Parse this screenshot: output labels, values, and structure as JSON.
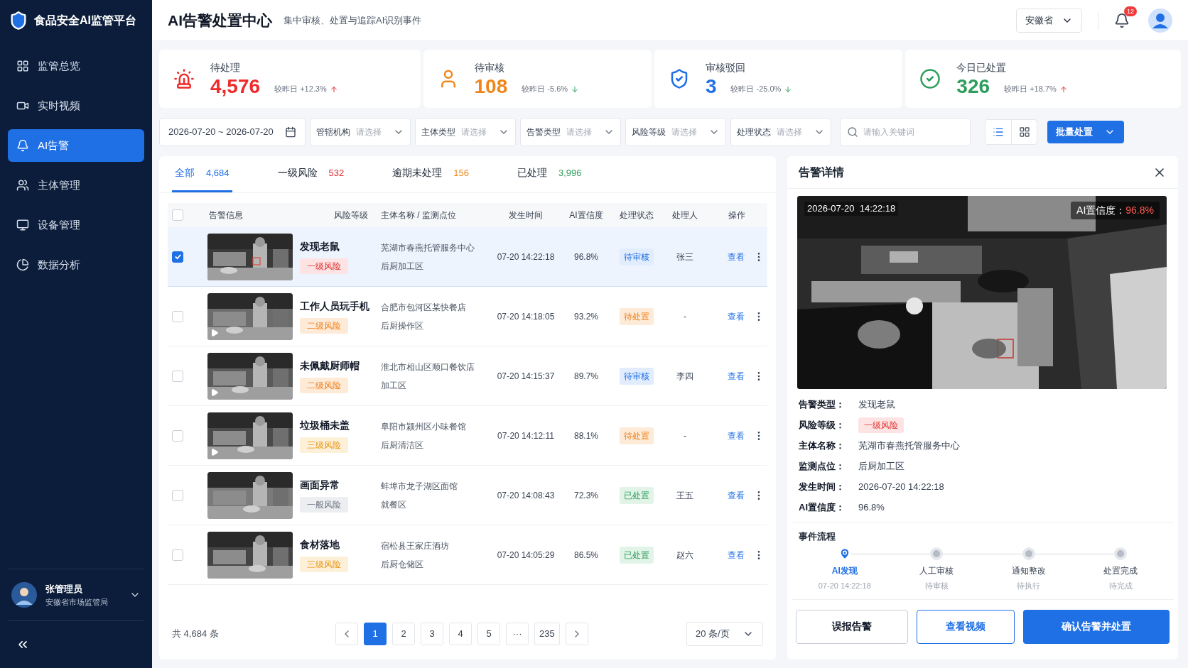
{
  "sidebar": {
    "brand": "食品安全AI监管平台",
    "items": [
      {
        "kind": "overview",
        "label": "监管总览",
        "selected": false
      },
      {
        "kind": "video",
        "label": "实时视频",
        "selected": false
      },
      {
        "kind": "alert",
        "label": "AI告警",
        "selected": true
      },
      {
        "kind": "entity",
        "label": "主体管理",
        "selected": false
      },
      {
        "kind": "device",
        "label": "设备管理",
        "selected": false
      },
      {
        "kind": "analytics",
        "label": "数据分析",
        "selected": false
      }
    ],
    "user": {
      "name": "张管理员",
      "org": "安徽省市场监管局"
    }
  },
  "header": {
    "title": "AI告警处置中心",
    "subtitle": "集中审核、处置与追踪AI识别事件",
    "region": "安徽省",
    "notification_count": "12"
  },
  "stats": [
    {
      "kind": "alarm",
      "label": "待处理",
      "value": "4,576",
      "color": "#ee2a2a",
      "compare": "较昨日 +12.3%",
      "rising": true
    },
    {
      "kind": "person",
      "label": "待审核",
      "value": "108",
      "color": "#f0861a",
      "compare": "较昨日 -5.6%",
      "rising": false
    },
    {
      "kind": "shield",
      "label": "审核驳回",
      "value": "3",
      "color": "#1f6fe5",
      "compare": "较昨日 -25.0%",
      "rising": false
    },
    {
      "kind": "check",
      "label": "今日已处置",
      "value": "326",
      "color": "#2e9d5c",
      "compare": "较昨日 +18.7%",
      "rising": true
    }
  ],
  "filters": {
    "date_range": "2026-07-20 ~ 2026-07-20",
    "selects": [
      {
        "label": "管辖机构",
        "placeholder": "请选择"
      },
      {
        "label": "主体类型",
        "placeholder": "请选择"
      },
      {
        "label": "告警类型",
        "placeholder": "请选择"
      },
      {
        "label": "风险等级",
        "placeholder": "请选择"
      },
      {
        "label": "处理状态",
        "placeholder": "请选择"
      }
    ],
    "search": {
      "placeholder": "请输入关键词"
    },
    "views": [
      {
        "kind": "list",
        "selected": true
      },
      {
        "kind": "grid",
        "selected": false
      }
    ],
    "batch_button": "批量处置"
  },
  "tabs": [
    {
      "label": "全部",
      "count": "4,684",
      "color": "#1f6fe5",
      "selected": true
    },
    {
      "label": "一级风险",
      "count": "532",
      "color": "#e02b2b",
      "selected": false
    },
    {
      "label": "逾期未处理",
      "count": "156",
      "color": "#f0861a",
      "selected": false
    },
    {
      "label": "已处理",
      "count": "3,996",
      "color": "#2e9d5c",
      "selected": false
    }
  ],
  "table": {
    "columns": [
      "告警信息",
      "风险等级",
      "主体名称 / 监测点位",
      "发生时间",
      "AI置信度",
      "处理状态",
      "处理人",
      "操作"
    ],
    "header_checked": false,
    "rows": [
      {
        "checked": true,
        "selected": true,
        "video": false,
        "title": "发现老鼠",
        "risk": {
          "kind": "l1",
          "label": "一级风险"
        },
        "subject": "芜湖市春燕托管服务中心",
        "location": "后厨加工区",
        "time": "07-20 14:22:18",
        "confidence": "96.8%",
        "status": {
          "kind": "review",
          "label": "待审核"
        },
        "handler": "张三",
        "action": "查看"
      },
      {
        "checked": false,
        "selected": false,
        "video": true,
        "title": "工作人员玩手机",
        "risk": {
          "kind": "l2",
          "label": "二级风险"
        },
        "subject": "合肥市包河区某快餐店",
        "location": "后厨操作区",
        "time": "07-20 14:18:05",
        "confidence": "93.2%",
        "status": {
          "kind": "pending",
          "label": "待处置"
        },
        "handler": "-",
        "action": "查看"
      },
      {
        "checked": false,
        "selected": false,
        "video": true,
        "title": "未佩戴厨师帽",
        "risk": {
          "kind": "l2",
          "label": "二级风险"
        },
        "subject": "淮北市相山区顺口餐饮店",
        "location": "加工区",
        "time": "07-20 14:15:37",
        "confidence": "89.7%",
        "status": {
          "kind": "review",
          "label": "待审核"
        },
        "handler": "李四",
        "action": "查看"
      },
      {
        "checked": false,
        "selected": false,
        "video": true,
        "title": "垃圾桶未盖",
        "risk": {
          "kind": "l3",
          "label": "三级风险"
        },
        "subject": "阜阳市颍州区小味餐馆",
        "location": "后厨清洁区",
        "time": "07-20 14:12:11",
        "confidence": "88.1%",
        "status": {
          "kind": "pending",
          "label": "待处置"
        },
        "handler": "-",
        "action": "查看"
      },
      {
        "checked": false,
        "selected": false,
        "video": false,
        "title": "画面异常",
        "risk": {
          "kind": "general",
          "label": "一般风险"
        },
        "subject": "蚌埠市龙子湖区面馆",
        "location": "就餐区",
        "time": "07-20 14:08:43",
        "confidence": "72.3%",
        "status": {
          "kind": "done",
          "label": "已处置"
        },
        "handler": "王五",
        "action": "查看"
      },
      {
        "checked": false,
        "selected": false,
        "video": false,
        "title": "食材落地",
        "risk": {
          "kind": "l3",
          "label": "三级风险"
        },
        "subject": "宿松县王家庄酒坊",
        "location": "后厨仓储区",
        "time": "07-20 14:05:29",
        "confidence": "86.5%",
        "status": {
          "kind": "done",
          "label": "已处置"
        },
        "handler": "赵六",
        "action": "查看"
      }
    ]
  },
  "pagination": {
    "total": "共 4,684 条",
    "pages": [
      {
        "label": "1",
        "selected": true
      },
      {
        "label": "2",
        "selected": false
      },
      {
        "label": "3",
        "selected": false
      },
      {
        "label": "4",
        "selected": false
      },
      {
        "label": "5",
        "selected": false
      },
      {
        "label": "···",
        "selected": false
      },
      {
        "label": "235",
        "selected": false
      }
    ],
    "page_size": "20 条/页"
  },
  "detail": {
    "title": "告警详情",
    "overlay_time": "2026-07-20  14:22:18",
    "overlay_conf_label": "AI置信度：",
    "overlay_conf_value": "96.8%",
    "fields": [
      {
        "kind": "text",
        "label": "告警类型：",
        "value": "发现老鼠"
      },
      {
        "kind": "badge",
        "label": "风险等级：",
        "badge": {
          "kind": "l1",
          "label": "一级风险"
        }
      },
      {
        "kind": "text",
        "label": "主体名称：",
        "value": "芜湖市春燕托管服务中心"
      },
      {
        "kind": "text",
        "label": "监测点位：",
        "value": "后厨加工区"
      },
      {
        "kind": "text",
        "label": "发生时间：",
        "value": "2026-07-20 14:22:18"
      },
      {
        "kind": "text",
        "label": "AI置信度：",
        "value": "96.8%"
      }
    ],
    "flow_title": "事件流程",
    "steps": [
      {
        "label": "AI发现",
        "sub": "07-20 14:22:18",
        "active": true
      },
      {
        "label": "人工审核",
        "sub": "待审核",
        "active": false
      },
      {
        "label": "通知整改",
        "sub": "待执行",
        "active": false
      },
      {
        "label": "处置完成",
        "sub": "待完成",
        "active": false
      }
    ],
    "buttons": [
      {
        "kind": "default",
        "label": "误报告警"
      },
      {
        "kind": "outline",
        "label": "查看视频"
      },
      {
        "kind": "primary",
        "label": "确认告警并处置"
      }
    ]
  }
}
